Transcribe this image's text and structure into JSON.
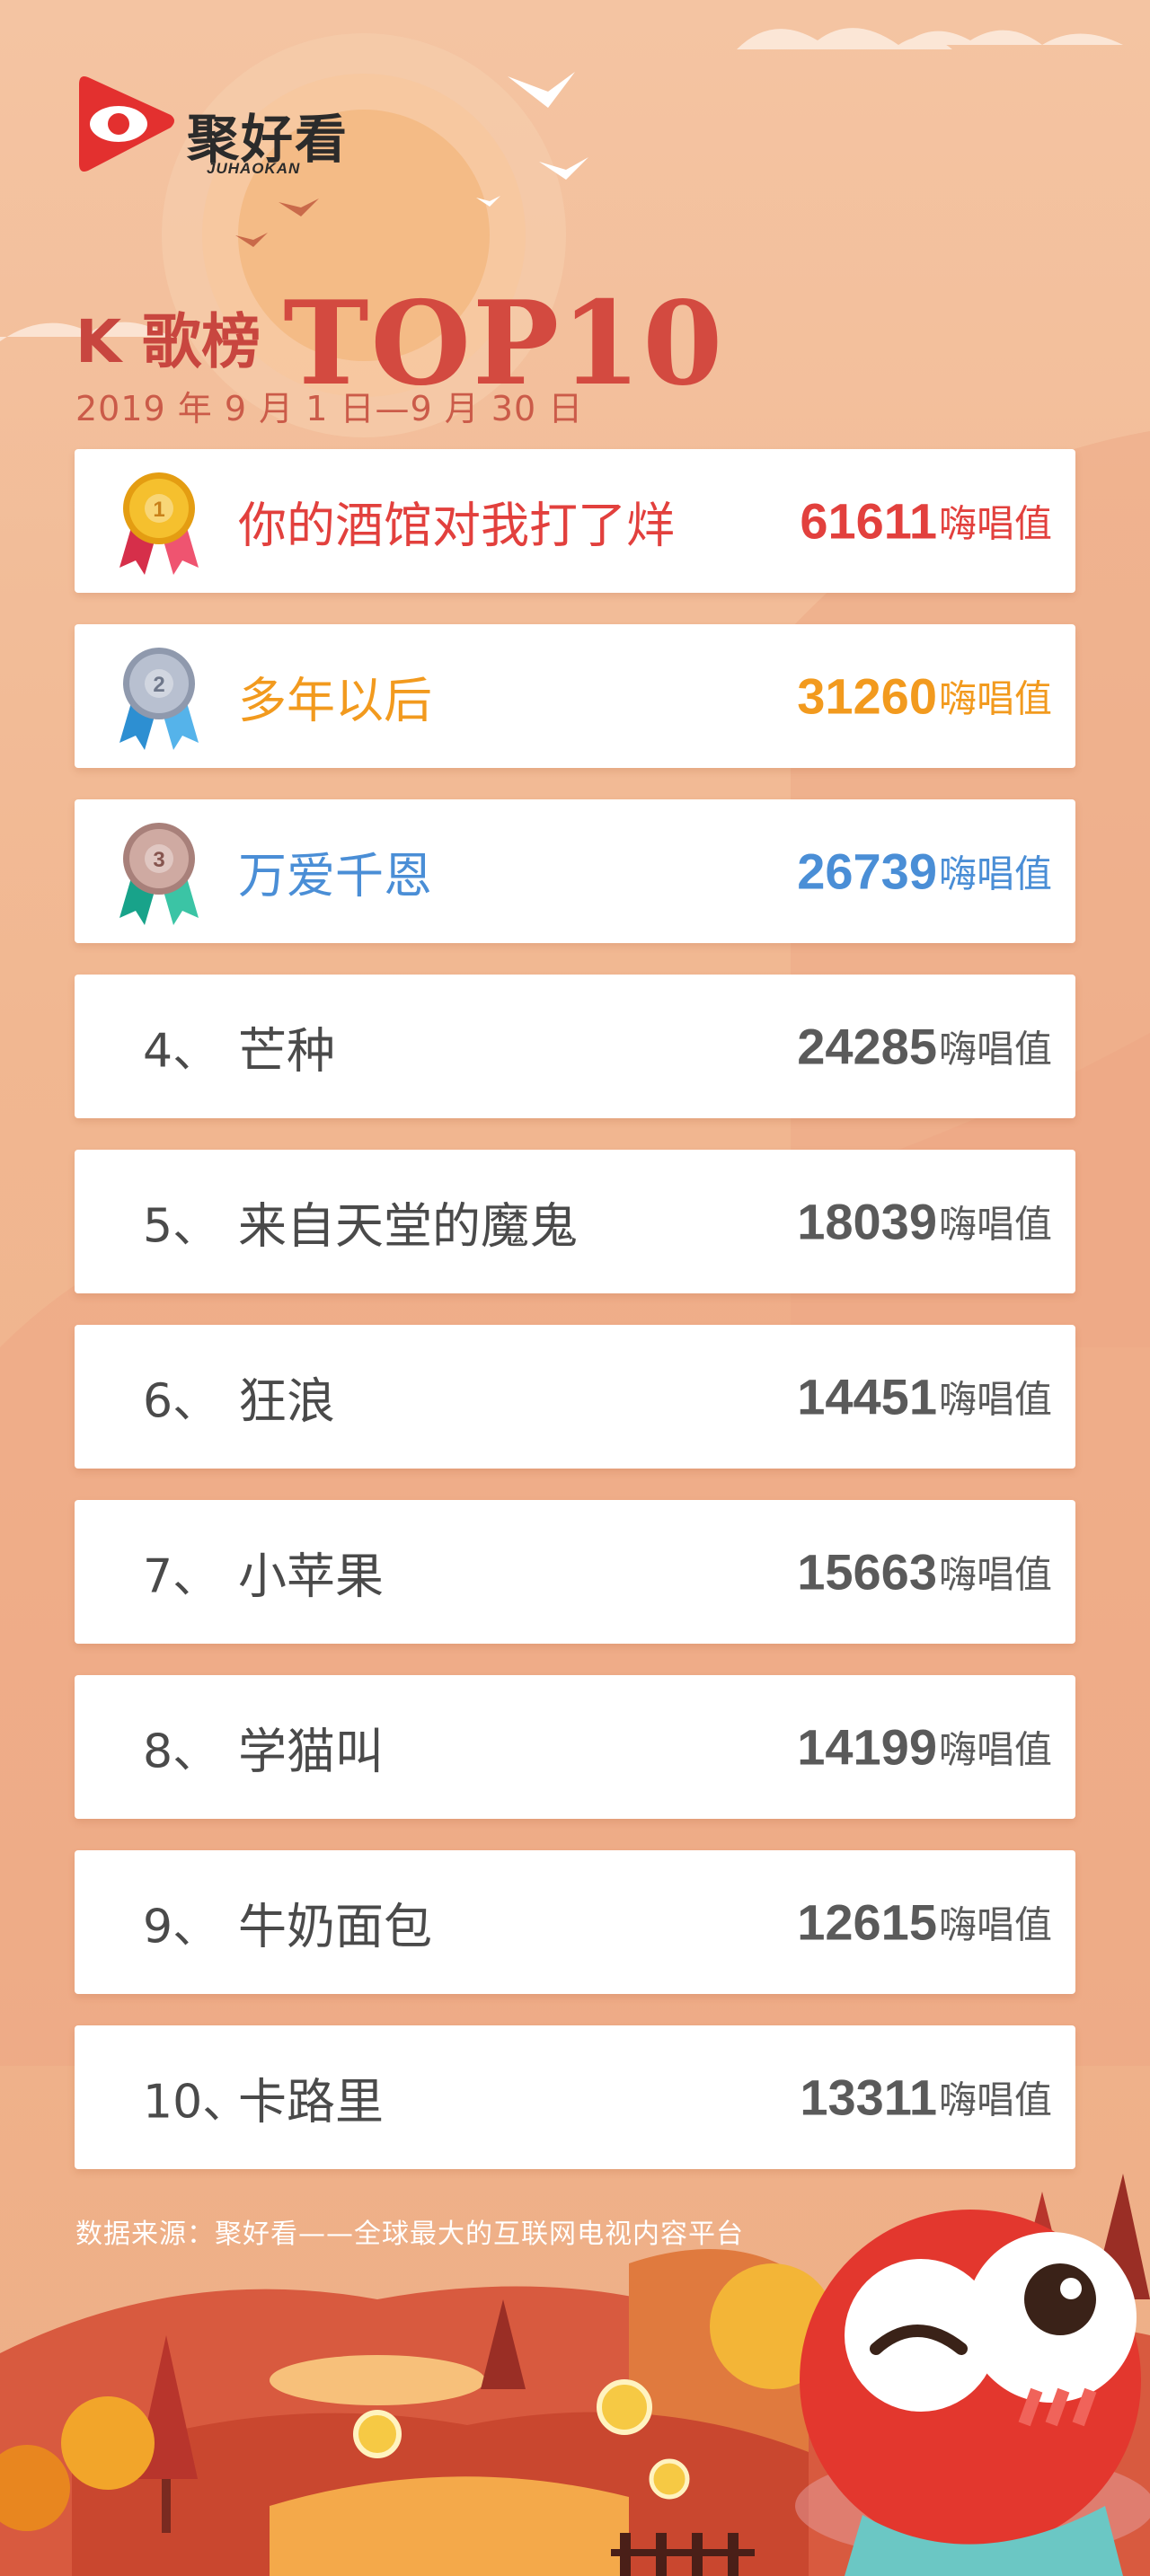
{
  "brand": {
    "name": "聚好看",
    "subtitle": "JUHAOKAN"
  },
  "heading": {
    "k_label": "K 歌榜",
    "top_label": "TOP10",
    "date_range": "2019 年 9 月 1 日—9 月 30 日"
  },
  "ranking": [
    {
      "rank": "1",
      "rank_label": "",
      "song": "你的酒馆对我打了烊",
      "score": "61611",
      "unit": "嗨唱值",
      "color": "#e2403d",
      "medal": "gold"
    },
    {
      "rank": "2",
      "rank_label": "",
      "song": "多年以后",
      "score": "31260",
      "unit": "嗨唱值",
      "color": "#f29a1e",
      "medal": "silver"
    },
    {
      "rank": "3",
      "rank_label": "",
      "song": "万爱千恩",
      "score": "26739",
      "unit": "嗨唱值",
      "color": "#4a8ed6",
      "medal": "bronze"
    },
    {
      "rank": "4",
      "rank_label": "4、",
      "song": "芒种",
      "score": "24285",
      "unit": "嗨唱值",
      "color": "#4a4a4a",
      "medal": ""
    },
    {
      "rank": "5",
      "rank_label": "5、",
      "song": "来自天堂的魔鬼",
      "score": "18039",
      "unit": "嗨唱值",
      "color": "#4a4a4a",
      "medal": ""
    },
    {
      "rank": "6",
      "rank_label": "6、",
      "song": "狂浪",
      "score": "14451",
      "unit": "嗨唱值",
      "color": "#4a4a4a",
      "medal": ""
    },
    {
      "rank": "7",
      "rank_label": "7、",
      "song": "小苹果",
      "score": "15663",
      "unit": "嗨唱值",
      "color": "#4a4a4a",
      "medal": ""
    },
    {
      "rank": "8",
      "rank_label": "8、",
      "song": "学猫叫",
      "score": "14199",
      "unit": "嗨唱值",
      "color": "#4a4a4a",
      "medal": ""
    },
    {
      "rank": "9",
      "rank_label": "9、",
      "song": "牛奶面包",
      "score": "12615",
      "unit": "嗨唱值",
      "color": "#4a4a4a",
      "medal": ""
    },
    {
      "rank": "10",
      "rank_label": "10、",
      "song": "卡路里",
      "score": "13311",
      "unit": "嗨唱值",
      "color": "#4a4a4a",
      "medal": ""
    }
  ],
  "footer": {
    "source_note": "数据来源：聚好看——全球最大的互联网电视内容平台"
  },
  "colors": {
    "accent_red": "#d34a40",
    "background": "#f2b993",
    "gold": "#f5c02e",
    "silver": "#aab4c8",
    "bronze": "#c9a49a"
  }
}
